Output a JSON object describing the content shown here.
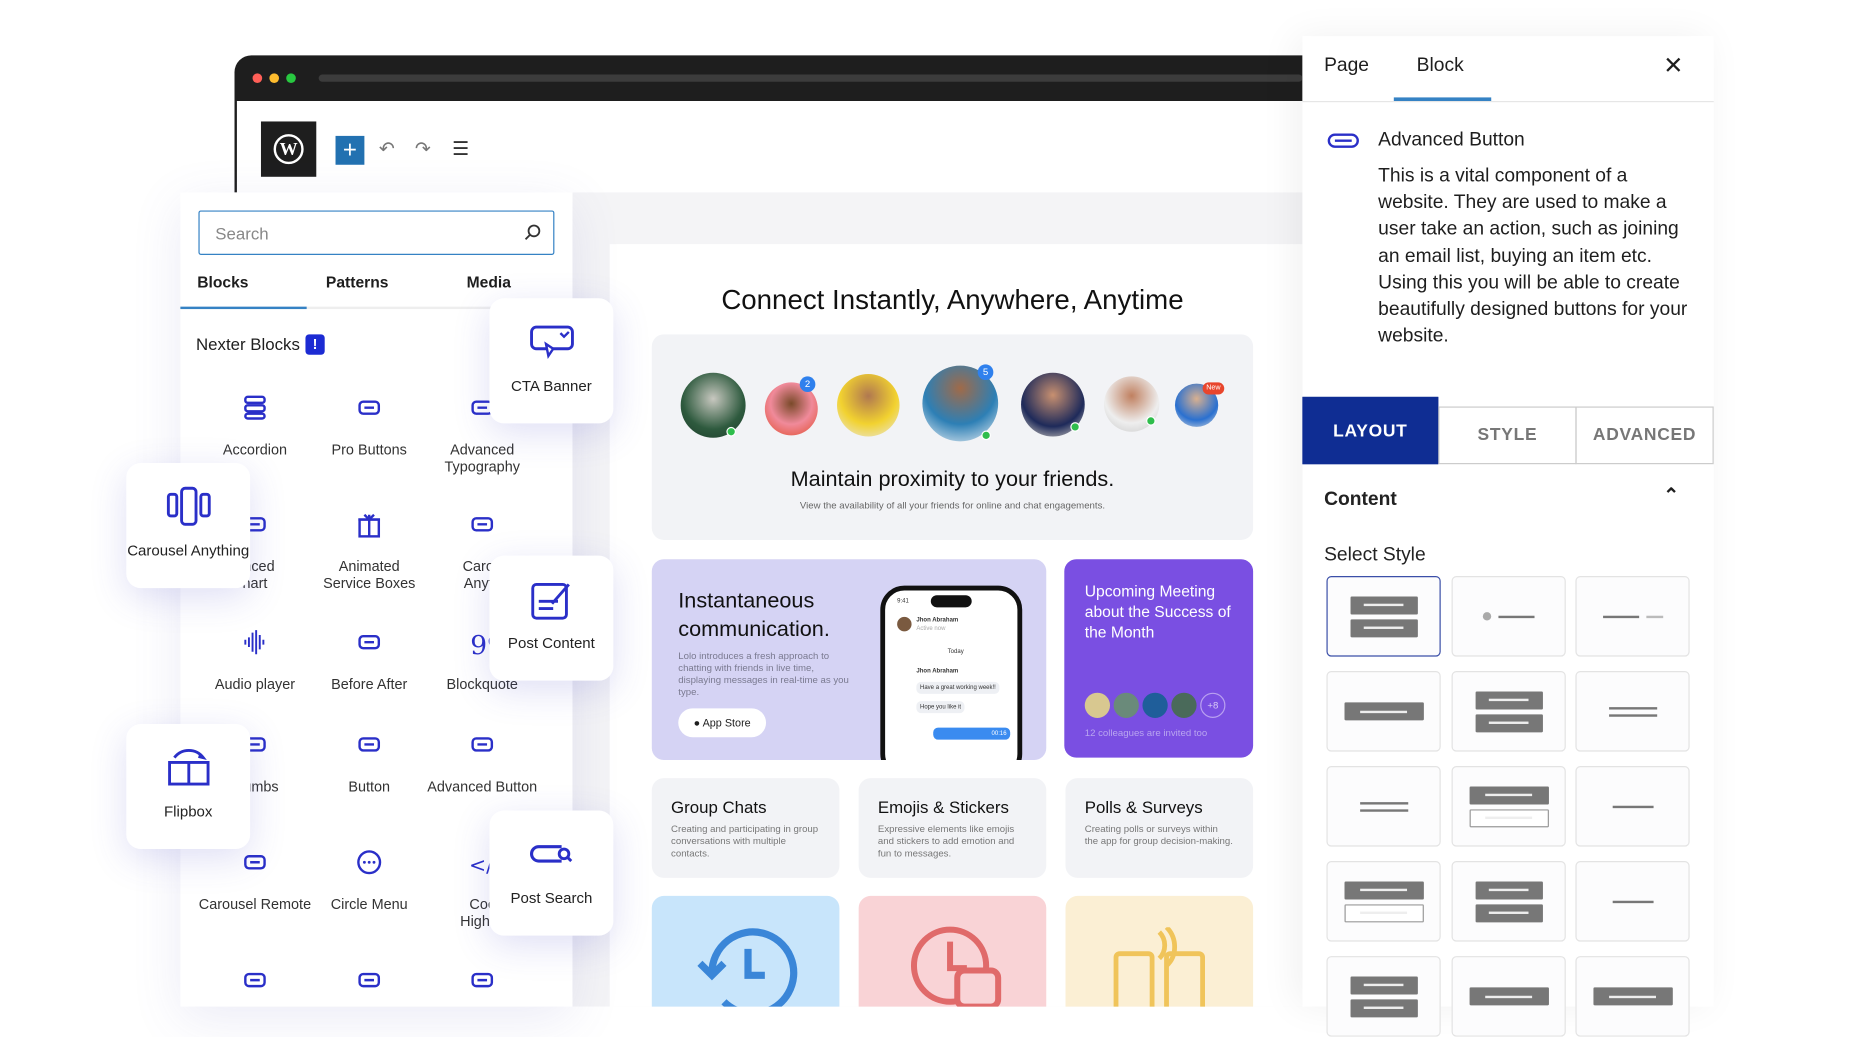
{
  "colors": {
    "accent": "#2271b1",
    "brand_blue": "#1c2bd3",
    "layout_tab": "#0f2d93",
    "meeting_card": "#7a4fe2",
    "inst_card": "#d5d3f4"
  },
  "toolbar": {
    "logo": "WordPress",
    "add_icon": "plus-icon",
    "undo_icon": "undo-icon",
    "redo_icon": "redo-icon",
    "outline_icon": "list-view-icon"
  },
  "inserter": {
    "search_placeholder": "Search",
    "tabs": [
      "Blocks",
      "Patterns",
      "Media"
    ],
    "active_tab": "Blocks",
    "section": "Nexter Blocks",
    "section_badge": "!",
    "blocks": [
      {
        "label": "Accordion",
        "icon": "accordion-icon"
      },
      {
        "label": "Pro Buttons",
        "icon": "pro-buttons-icon"
      },
      {
        "label": "Advanced Typography",
        "icon": "typography-icon"
      },
      {
        "label": "Advanced Chart",
        "visible": "anced\nhart",
        "icon": "chart-icon"
      },
      {
        "label": "Animated Service Boxes",
        "icon": "gift-icon"
      },
      {
        "label": "Carousel Anything",
        "visible": "Carou\nAnyth",
        "icon": "carousel-icon"
      },
      {
        "label": "Audio player",
        "icon": "audio-icon"
      },
      {
        "label": "Before After",
        "icon": "before-after-icon"
      },
      {
        "label": "Blockquote",
        "icon": "quote-icon"
      },
      {
        "label": "crumbs",
        "icon": "breadcrumbs-icon"
      },
      {
        "label": "Button",
        "icon": "button-icon"
      },
      {
        "label": "Advanced Button",
        "icon": "advanced-button-icon"
      },
      {
        "label": "Carousel Remote",
        "icon": "remote-icon"
      },
      {
        "label": "Circle Menu",
        "icon": "circle-menu-icon"
      },
      {
        "label": "Coc\nHighlig",
        "icon": "code-icon"
      },
      {
        "icon": "ticket-icon"
      },
      {
        "icon": "barcode-icon"
      },
      {
        "icon": "timer-icon"
      }
    ],
    "floating": [
      {
        "label": "CTA Banner"
      },
      {
        "label": "Carousel Anything"
      },
      {
        "label": "Post Content"
      },
      {
        "label": "Flipbox"
      },
      {
        "label": "Post Search"
      }
    ]
  },
  "page": {
    "headline": "Connect Instantly, Anywhere, Anytime",
    "friends": {
      "title": "Maintain proximity to your friends.",
      "subtitle": "View the availability of all your friends for online and chat engagements.",
      "badges": [
        "2",
        "5",
        "New"
      ]
    },
    "inst": {
      "title_1": "Instantaneous",
      "title_2": "communication.",
      "body": "Lolo introduces a fresh approach to chatting with friends in live time, displaying messages in real-time as you type.",
      "button": "App Store",
      "phone": {
        "time": "9:41",
        "contact": "Jhon Abraham",
        "status": "Active now",
        "day": "Today",
        "msg1": "Have a great working week!!",
        "msg2": "Hope you like it",
        "voice": "00:16"
      }
    },
    "meeting": {
      "title": "Upcoming Meeting about the Success of the Month",
      "more": "+8",
      "note": "12 colleagues are invited too"
    },
    "features": [
      {
        "title": "Group Chats",
        "body": "Creating and participating in group conversations with multiple contacts."
      },
      {
        "title": "Emojis & Stickers",
        "body": "Expressive elements like emojis and stickers to add emotion and fun to messages."
      },
      {
        "title": "Polls & Surveys",
        "body": "Creating polls or surveys within the app for group decision-making."
      }
    ]
  },
  "right_panel": {
    "tabs": [
      "Page",
      "Block"
    ],
    "active_tab": "Block",
    "block_title": "Advanced Button",
    "block_desc": "This is a vital component of a website. They are used to make a user take an action, such as joining an email list, buying an item etc. Using this you will be able to create beautifully designed buttons for your website.",
    "setting_tabs": [
      "LAYOUT",
      "STYLE",
      "ADVANCED"
    ],
    "active_setting_tab": "LAYOUT",
    "section": "Content",
    "select_style": "Select Style",
    "selected_style": 1
  }
}
